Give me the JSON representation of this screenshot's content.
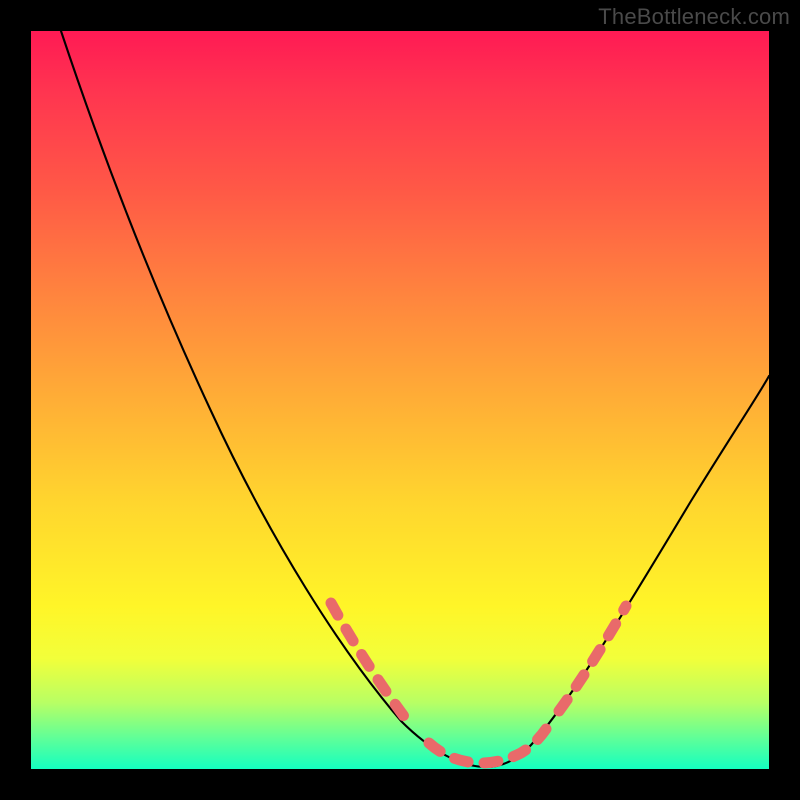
{
  "watermark": "TheBottleneck.com",
  "chart_data": {
    "type": "line",
    "title": "",
    "xlabel": "",
    "ylabel": "",
    "xlim": [
      0,
      100
    ],
    "ylim": [
      0,
      100
    ],
    "grid": false,
    "legend": false,
    "series": [
      {
        "name": "main-curve",
        "color": "#000000",
        "x": [
          4,
          10,
          18,
          25,
          32,
          38,
          43,
          48,
          52,
          56,
          59,
          62,
          65,
          68,
          71,
          75,
          80,
          86,
          92,
          100
        ],
        "y": [
          100,
          84,
          67,
          53,
          40,
          29,
          20,
          12,
          6,
          3,
          1,
          0.5,
          1,
          3,
          7,
          14,
          23,
          34,
          44,
          54
        ]
      },
      {
        "name": "highlight-left",
        "style": "dotted",
        "color": "#e96a6a",
        "x": [
          41,
          44,
          47,
          50,
          53
        ],
        "y": [
          22,
          17,
          12,
          8,
          5
        ]
      },
      {
        "name": "highlight-bottom",
        "style": "dotted",
        "color": "#e96a6a",
        "x": [
          55,
          58,
          61,
          64,
          67
        ],
        "y": [
          2,
          1,
          0.5,
          1,
          2
        ]
      },
      {
        "name": "highlight-right",
        "style": "dotted",
        "color": "#e96a6a",
        "x": [
          70,
          73,
          76,
          79
        ],
        "y": [
          7,
          12,
          17,
          22
        ]
      }
    ]
  }
}
